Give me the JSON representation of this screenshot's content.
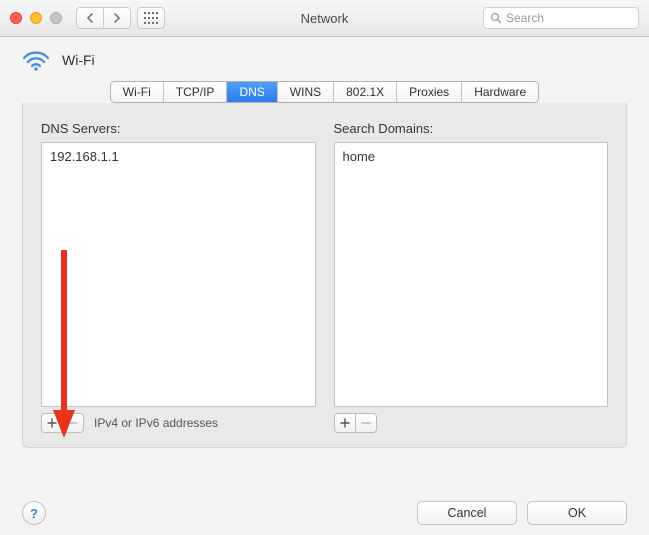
{
  "window": {
    "title": "Network"
  },
  "search": {
    "placeholder": "Search"
  },
  "header": {
    "connection_name": "Wi-Fi"
  },
  "tabs": [
    {
      "label": "Wi-Fi",
      "active": false
    },
    {
      "label": "TCP/IP",
      "active": false
    },
    {
      "label": "DNS",
      "active": true
    },
    {
      "label": "WINS",
      "active": false
    },
    {
      "label": "802.1X",
      "active": false
    },
    {
      "label": "Proxies",
      "active": false
    },
    {
      "label": "Hardware",
      "active": false
    }
  ],
  "dns": {
    "label": "DNS Servers:",
    "servers": [
      "192.168.1.1"
    ],
    "hint": "IPv4 or IPv6 addresses"
  },
  "searchDomains": {
    "label": "Search Domains:",
    "domains": [
      "home"
    ]
  },
  "buttons": {
    "cancel": "Cancel",
    "ok": "OK",
    "help": "?"
  },
  "colors": {
    "accent": "#2d7cec",
    "arrow": "#e6321f"
  }
}
